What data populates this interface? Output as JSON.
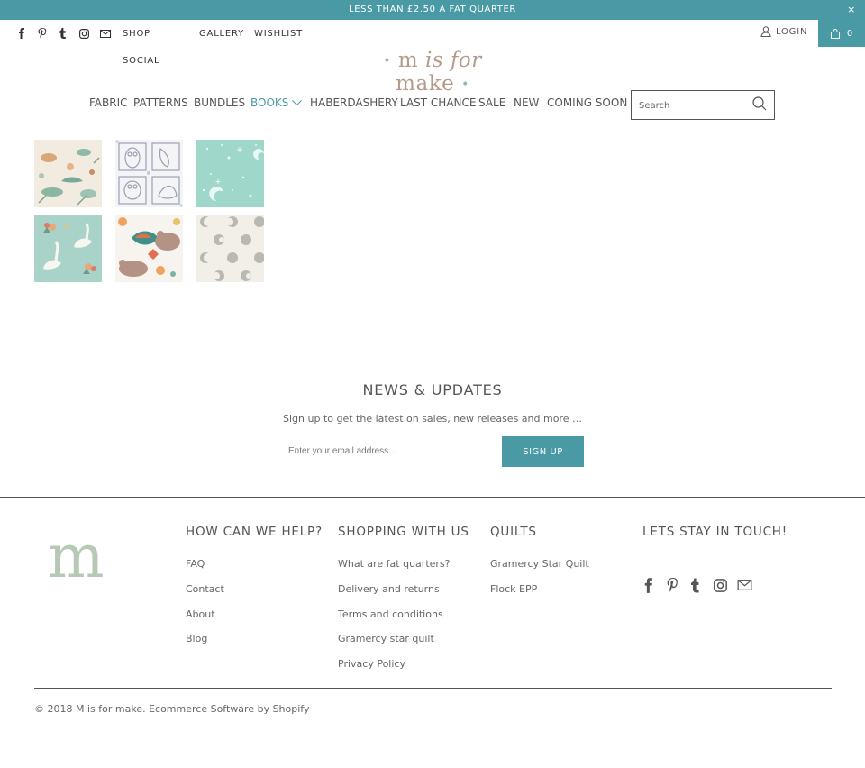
{
  "announcement": {
    "text": "LESS THAN £2.50 A FAT QUARTER",
    "close": "×"
  },
  "header": {
    "social_icons": [
      "facebook-icon",
      "pinterest-icon",
      "tumblr-icon",
      "instagram-icon",
      "email-icon"
    ],
    "top_links": {
      "shop": "SHOP",
      "social": "SOCIAL",
      "gallery": "GALLERY",
      "wishlist": "WISHLIST"
    },
    "login": "LOGIN",
    "cart_count": "0",
    "logo": {
      "pre": "m",
      "mid": "is for",
      "post": "make"
    }
  },
  "menu": {
    "items": [
      {
        "label": "FABRIC"
      },
      {
        "label": "PATTERNS"
      },
      {
        "label": "BUNDLES"
      },
      {
        "label": "BOOKS",
        "active": true,
        "dropdown": true
      },
      {
        "label": "HABERDASHERY"
      },
      {
        "label": "LAST CHANCE"
      },
      {
        "label": "SALE"
      },
      {
        "label": "NEW"
      },
      {
        "label": "COMING SOON"
      }
    ]
  },
  "search": {
    "placeholder": "Search"
  },
  "products": {
    "tiles": [
      "botanical-hare-print",
      "owl-sketch-print",
      "mint-moon-stars-print",
      "swan-floral-print",
      "bear-butterfly-print",
      "moon-phases-print"
    ]
  },
  "newsletter": {
    "title": "NEWS & UPDATES",
    "subtitle": "Sign up to get the latest on sales, new releases and more …",
    "email_placeholder": "Enter your email address...",
    "button": "SIGN UP"
  },
  "footer": {
    "logo_letter": "m",
    "col1": {
      "title": "HOW CAN WE HELP?",
      "links": [
        "FAQ",
        "Contact",
        "About",
        "Blog"
      ]
    },
    "col2": {
      "title": "SHOPPING WITH US",
      "links": [
        "What are fat quarters?",
        "Delivery and returns",
        "Terms and conditions",
        "Gramercy star quilt",
        "Privacy Policy"
      ]
    },
    "col3": {
      "title": "QUILTS",
      "links": [
        "Gramercy Star Quilt",
        "Flock EPP"
      ]
    },
    "col4": {
      "title": "LETS STAY IN TOUCH!"
    },
    "copyright": "© 2018 M is for make. Ecommerce Software by Shopify"
  },
  "colors": {
    "accent": "#4a9aa5",
    "text": "#555555",
    "logo": "#b59a8a",
    "footer_logo": "#b5c9b4"
  }
}
